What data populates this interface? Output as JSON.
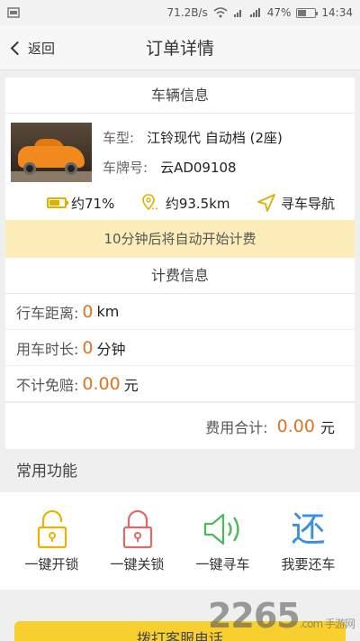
{
  "status_bar": {
    "speed": "71.2B/s",
    "battery": "47%",
    "battery_level": 0.47,
    "time": "14:34"
  },
  "nav": {
    "back_label": "返回",
    "title": "订单详情"
  },
  "vehicle_section": {
    "title": "车辆信息",
    "model_label": "车型:",
    "model_value": "江铃现代 自动档 (2座)",
    "plate_label": "车牌号:",
    "plate_value": "云AD09108",
    "battery_text": "约71%",
    "battery_level": 0.71,
    "range_text": "约93.5km",
    "navigate_label": "寻车导航",
    "accent_color": "#e0b000"
  },
  "notice": "10分钟后将自动开始计费",
  "fee_section": {
    "title": "计费信息",
    "distance_label": "行车距离:",
    "distance_value": "0",
    "distance_unit": "km",
    "duration_label": "用车时长:",
    "duration_value": "0",
    "duration_unit": "分钟",
    "insurance_label": "不计免赔:",
    "insurance_value": "0.00",
    "insurance_unit": "元",
    "total_label": "费用合计:",
    "total_value": "0.00",
    "total_unit": "元",
    "value_color": "#e2731f"
  },
  "common": {
    "title": "常用功能",
    "items": [
      {
        "label": "一键开锁",
        "icon": "unlock-icon",
        "color": "#e8b400"
      },
      {
        "label": "一键关锁",
        "icon": "lock-icon",
        "color": "#e06a6a"
      },
      {
        "label": "一键寻车",
        "icon": "speaker-icon",
        "color": "#4fb85a"
      },
      {
        "label": "我要还车",
        "icon": "return-icon",
        "glyph": "还",
        "color": "#3c8fe0"
      }
    ]
  },
  "call_button": "拨打客服电话",
  "watermark": {
    "text": "2265",
    "sub": ".com 手游网"
  }
}
